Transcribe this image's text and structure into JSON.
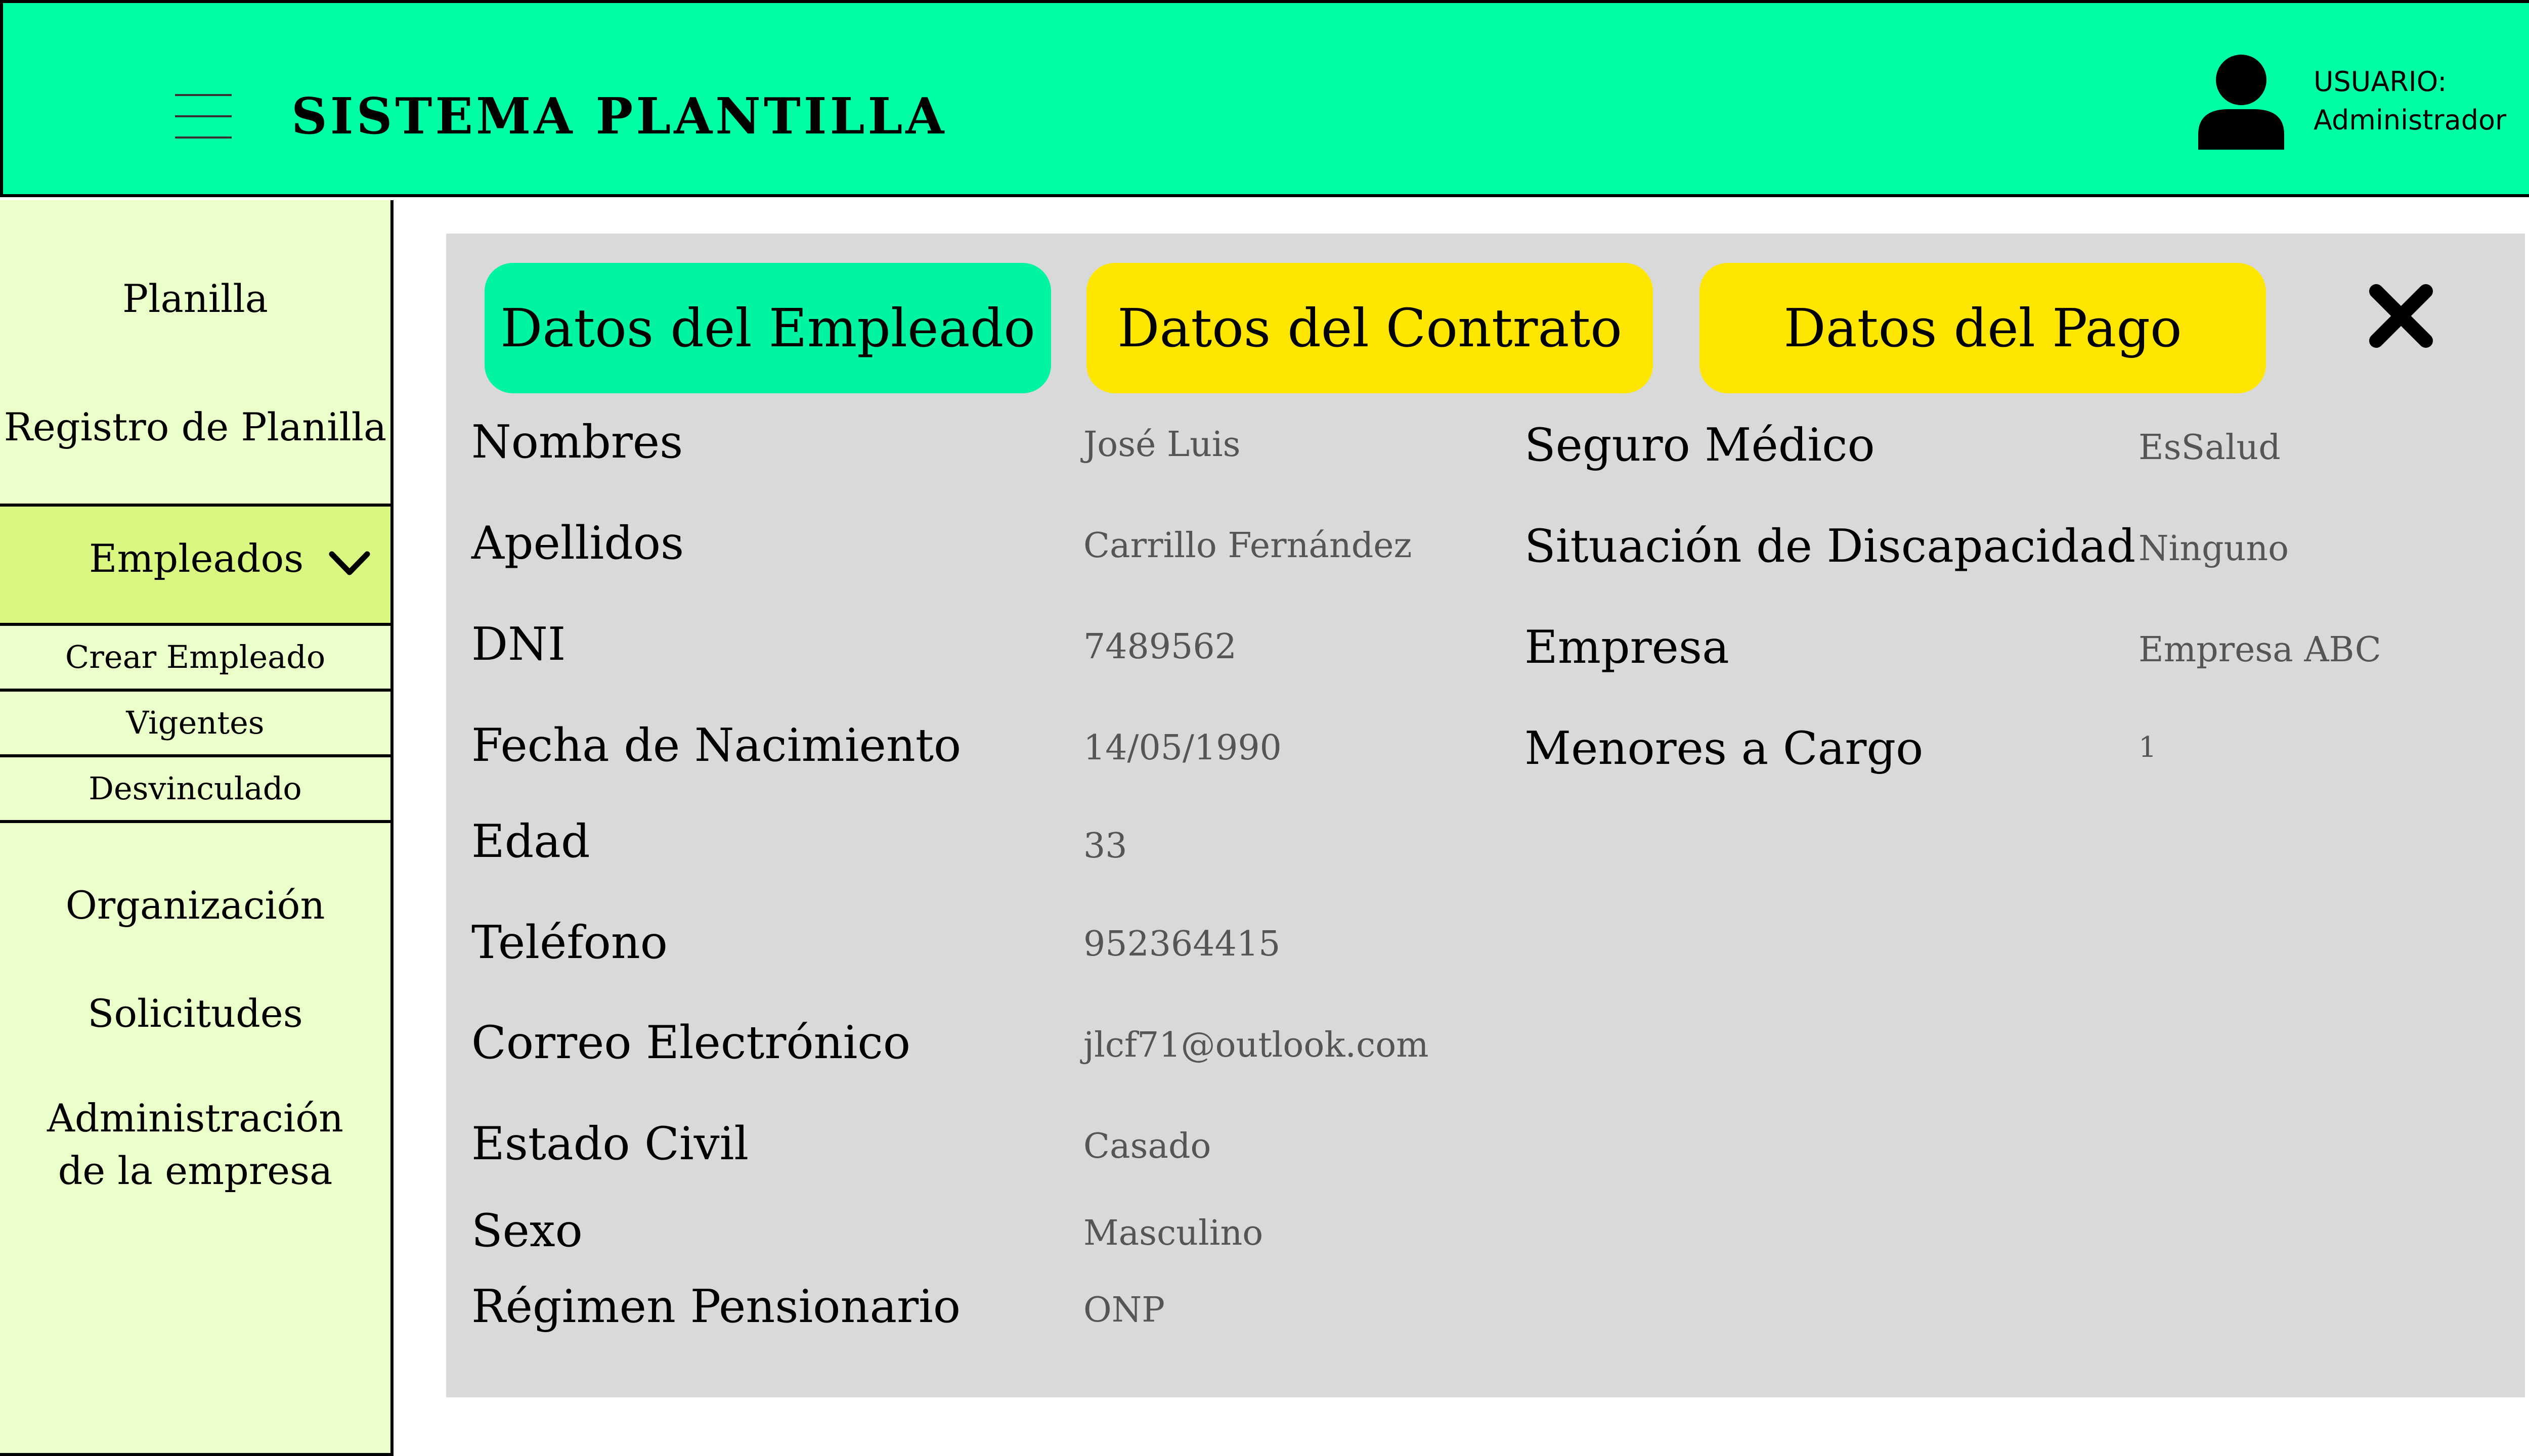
{
  "header": {
    "app_title": "SISTEMA PLANTILLA",
    "user_label": "USUARIO:",
    "user_name": "Administrador",
    "colors": {
      "header_bg": "#00ffa5"
    }
  },
  "sidebar": {
    "items": [
      {
        "label": "Planilla"
      },
      {
        "label": "Registro de Planilla"
      },
      {
        "label": "Empleados",
        "expanded": true
      },
      {
        "label": "Organización"
      },
      {
        "label": "Solicitudes"
      },
      {
        "label": "Administración",
        "label_line2": "de la empresa"
      }
    ],
    "sub_items": [
      {
        "label": "Crear Empleado"
      },
      {
        "label": "Vigentes"
      },
      {
        "label": "Desvinculado"
      }
    ],
    "colors": {
      "bg": "#eaffc9",
      "active_bg": "#d9f781"
    }
  },
  "tabs": [
    {
      "label": "Datos del Empleado",
      "active": true,
      "color": "#00f5a0"
    },
    {
      "label": "Datos del Contrato",
      "active": false,
      "color": "#ffe600"
    },
    {
      "label": "Datos del Pago",
      "active": false,
      "color": "#ffe600"
    }
  ],
  "icons": [
    "menu-icon",
    "user-icon",
    "chevron-down-icon",
    "close-icon"
  ],
  "employee": {
    "left": [
      {
        "label": "Nombres",
        "value": "José Luis"
      },
      {
        "label": "Apellidos",
        "value": "Carrillo Fernández"
      },
      {
        "label": "DNI",
        "value": "7489562"
      },
      {
        "label": "Fecha de Nacimiento",
        "value": "14/05/1990"
      },
      {
        "label": "Edad",
        "value": "33"
      },
      {
        "label": "Teléfono",
        "value": "952364415"
      },
      {
        "label": "Correo Electrónico",
        "value": "jlcf71@outlook.com"
      },
      {
        "label": "Estado Civil",
        "value": "Casado"
      },
      {
        "label": "Sexo",
        "value": "Masculino"
      },
      {
        "label": "Régimen Pensionario",
        "value": "ONP"
      }
    ],
    "right": [
      {
        "label": "Seguro Médico",
        "value": "EsSalud"
      },
      {
        "label": "Situación de Discapacidad",
        "value": "Ninguno"
      },
      {
        "label": "Empresa",
        "value": "Empresa ABC"
      },
      {
        "label": "Menores a Cargo",
        "value": "1"
      }
    ]
  }
}
